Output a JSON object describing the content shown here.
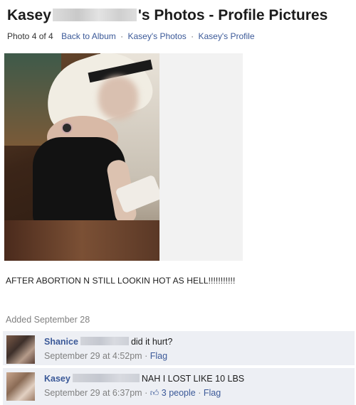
{
  "header": {
    "title_name": "Kasey",
    "title_rest": "'s Photos - Profile Pictures"
  },
  "nav": {
    "photo_count": "Photo 4 of 4",
    "back_to_album": "Back to Album",
    "sep": "·",
    "photos_link": "Kasey's Photos",
    "profile_link": "Kasey's Profile"
  },
  "caption": "AFTER ABORTION N STILL LOOKIN HOT AS HELL!!!!!!!!!!!",
  "added": "Added September 28",
  "comments": [
    {
      "name": "Shanice",
      "text": "did it hurt?",
      "time": "September 29 at 4:52pm",
      "sep": "·",
      "flag": "Flag"
    },
    {
      "name": "Kasey",
      "text": "NAH I LOST LIKE 10 LBS",
      "time": "September 29 at 6:37pm",
      "sep": "·",
      "likes": "3 people",
      "sep2": "·",
      "flag": "Flag"
    }
  ],
  "icons": {
    "thumbs_up": "thumbs-up-icon"
  },
  "colors": {
    "link": "#3b5998",
    "comment_bg": "#edeff4",
    "muted": "#808080"
  }
}
